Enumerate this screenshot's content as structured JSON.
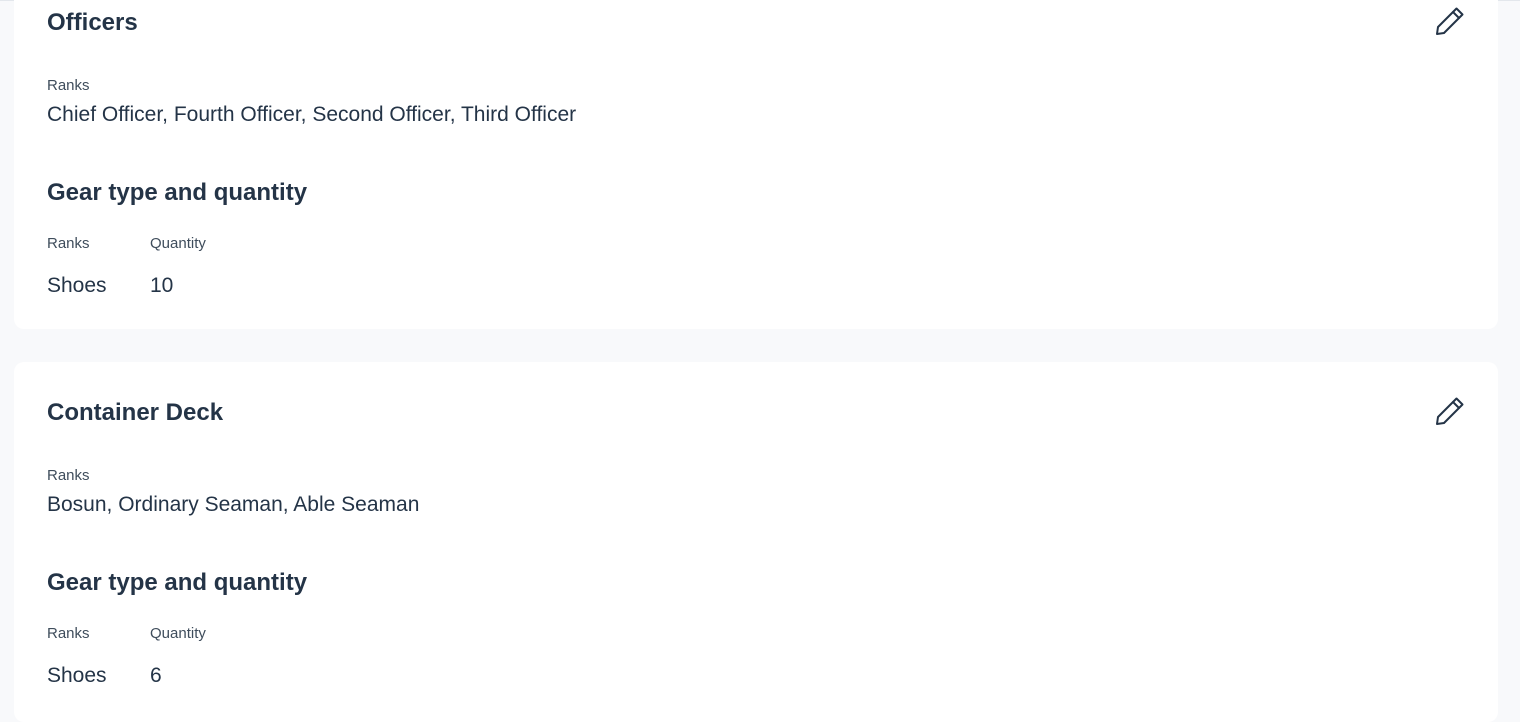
{
  "groups": [
    {
      "title": "Officers",
      "ranks_label": "Ranks",
      "ranks_value": "Chief Officer, Fourth Officer, Second Officer, Third Officer",
      "gear_title": "Gear type and quantity",
      "gear_headers": {
        "rank": "Ranks",
        "quantity": "Quantity"
      },
      "gear_rows": [
        {
          "type": "Shoes",
          "quantity": "10"
        }
      ],
      "edit_icon": "pencil-icon"
    },
    {
      "title": "Container Deck",
      "ranks_label": "Ranks",
      "ranks_value": "Bosun, Ordinary Seaman, Able Seaman",
      "gear_title": "Gear type and quantity",
      "gear_headers": {
        "rank": "Ranks",
        "quantity": "Quantity"
      },
      "gear_rows": [
        {
          "type": "Shoes",
          "quantity": "6"
        }
      ],
      "edit_icon": "pencil-icon"
    }
  ],
  "colors": {
    "background": "#f8f9fb",
    "card": "#ffffff",
    "text": "#243447"
  }
}
